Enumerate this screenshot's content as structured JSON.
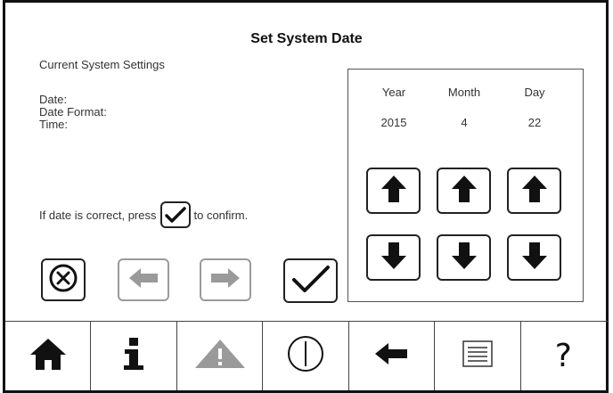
{
  "screen": {
    "title": "Set System Date",
    "settings_label": "Current System Settings"
  },
  "current": {
    "date_label": "Date:",
    "format_label": "Date Format:",
    "time_label": "Time:"
  },
  "confirm": {
    "before": "If date is correct, press",
    "after": "to confirm."
  },
  "date_picker": {
    "columns": [
      {
        "label": "Year",
        "value": "2015"
      },
      {
        "label": "Month",
        "value": "4"
      },
      {
        "label": "Day",
        "value": "22"
      }
    ]
  },
  "actions": {
    "cancel_icon": "circle-x-icon",
    "prev_icon": "arrow-left-icon",
    "next_icon": "arrow-right-icon",
    "confirm_icon": "checkmark-icon",
    "prev_disabled": true,
    "next_disabled": true
  },
  "nav": {
    "items": [
      {
        "icon": "home-icon"
      },
      {
        "icon": "info-icon"
      },
      {
        "icon": "warning-icon",
        "disabled": true
      },
      {
        "icon": "power-icon"
      },
      {
        "icon": "back-arrow-icon"
      },
      {
        "icon": "list-icon"
      },
      {
        "icon": "help-icon",
        "label": "?"
      }
    ]
  },
  "colors": {
    "primary": "#111111",
    "disabled": "#9a9a9a",
    "text": "#333333"
  }
}
